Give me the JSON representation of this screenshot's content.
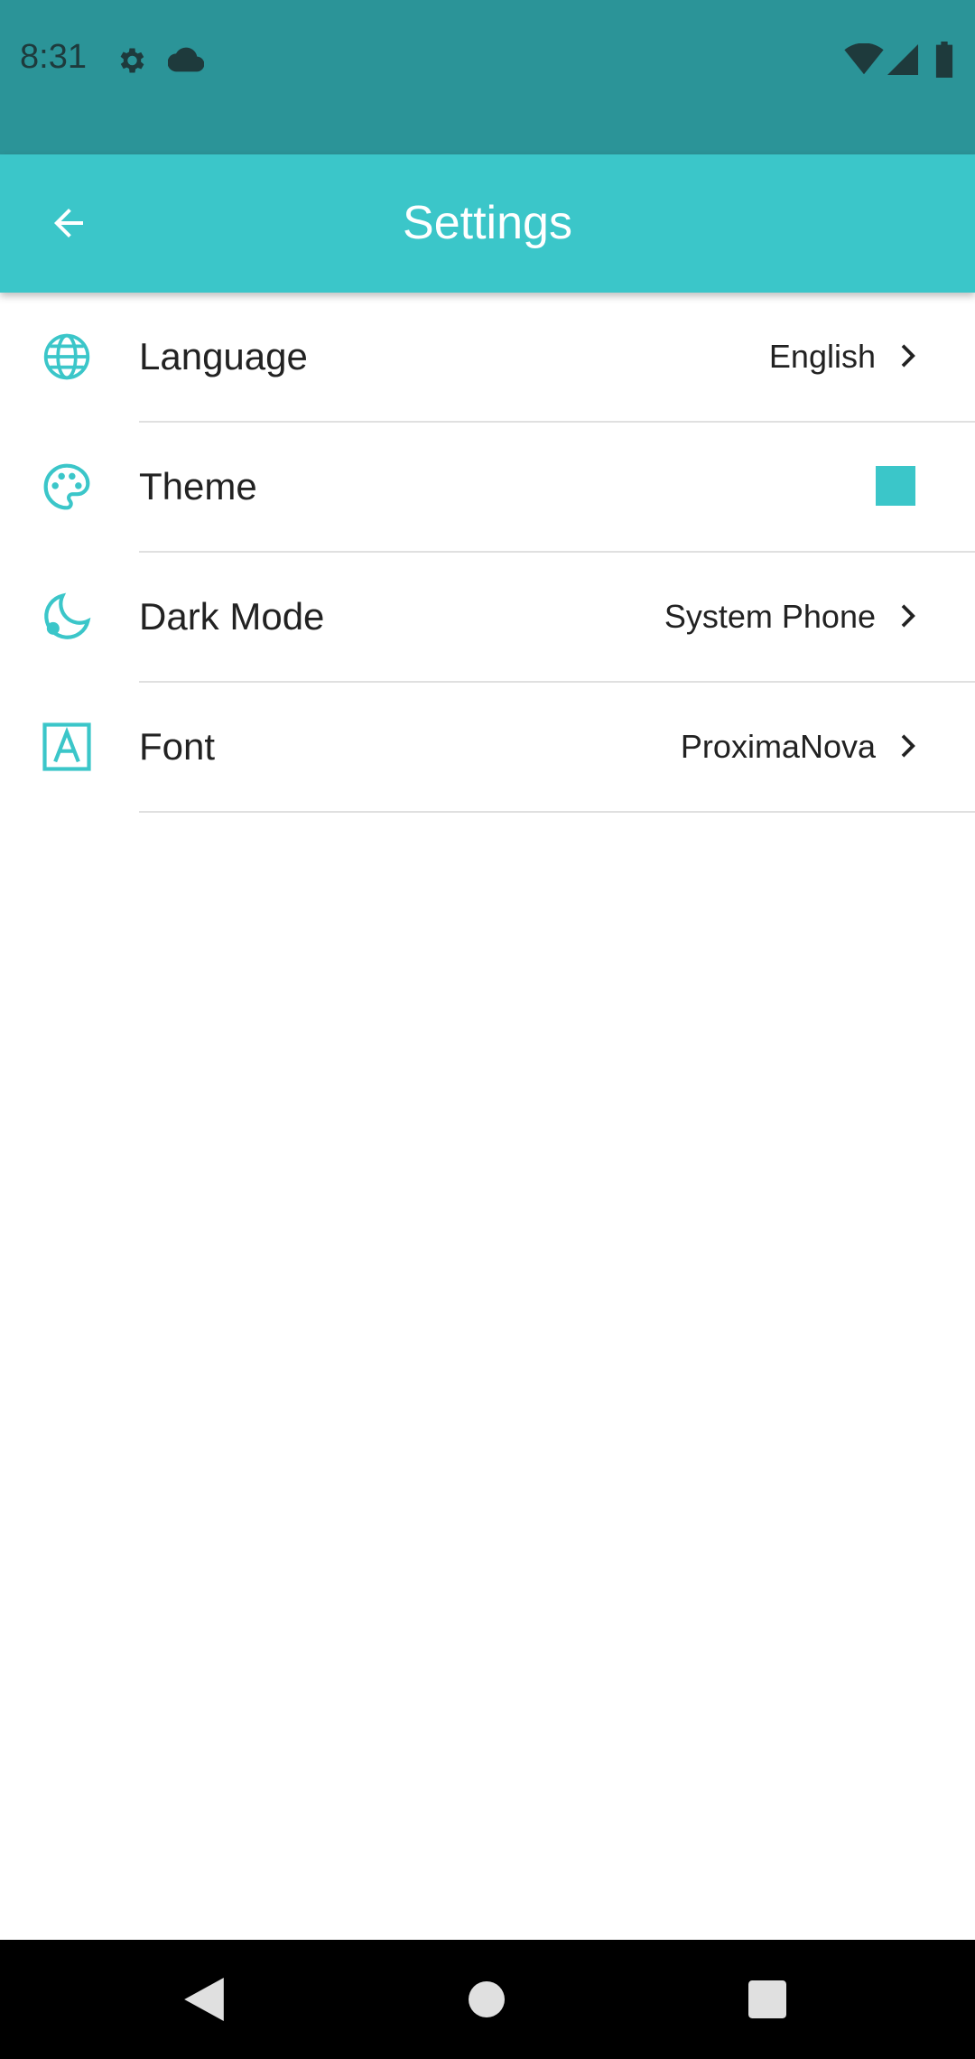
{
  "status_bar": {
    "time": "8:31",
    "left_icons": [
      "gear-icon",
      "cloud-icon"
    ],
    "right_icons": [
      "wifi-icon",
      "signal-icon",
      "battery-icon"
    ],
    "color": "#2b9498"
  },
  "app_bar": {
    "title": "Settings",
    "back_icon": "arrow-back-icon",
    "color": "#3bc6c9"
  },
  "settings": {
    "items": [
      {
        "icon": "globe-icon",
        "label": "Language",
        "value": "English",
        "chevron": true
      },
      {
        "icon": "palette-icon",
        "label": "Theme",
        "swatch_color": "#3bc6c9"
      },
      {
        "icon": "moon-icon",
        "label": "Dark Mode",
        "value": "System Phone",
        "chevron": true
      },
      {
        "icon": "font-icon",
        "label": "Font",
        "value": "ProximaNova",
        "chevron": true
      }
    ]
  },
  "nav_bar": {
    "buttons": [
      "back-triangle-icon",
      "home-circle-icon",
      "recents-square-icon"
    ]
  }
}
